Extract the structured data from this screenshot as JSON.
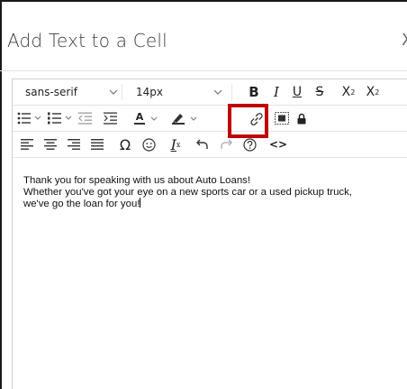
{
  "dialog": {
    "title": "Add Text to a Cell",
    "close_glyph": "X"
  },
  "toolbar": {
    "font_family": "sans-serif",
    "font_size": "14px",
    "bold": "B",
    "italic": "I",
    "underline": "U",
    "strikethrough": "S",
    "superscript_base": "X",
    "superscript_mark": "2",
    "subscript_base": "X",
    "subscript_mark": "2",
    "text_color": "A",
    "omega": "Ω",
    "clear_format": "I",
    "clear_format_sub": "x",
    "code": "<>",
    "link_highlight_color": "#c00000"
  },
  "content": {
    "lines": [
      "Thank you for speaking with us about Auto Loans!",
      "Whether you've got your eye on a new sports car or a used pickup truck,",
      "we've go the loan for you!"
    ]
  }
}
